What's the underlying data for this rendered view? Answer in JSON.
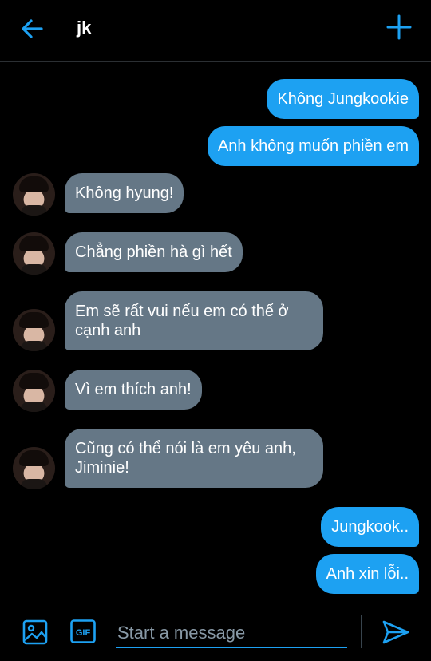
{
  "header": {
    "title": "jk",
    "back_icon": "arrow-left-icon",
    "compose_icon": "plus-icon",
    "accent": "#1da1f2"
  },
  "messages": [
    {
      "side": "out",
      "text": "Không Jungkookie"
    },
    {
      "side": "out",
      "text": "Anh không muốn phiền em"
    },
    {
      "side": "in",
      "text": "Không hyung!"
    },
    {
      "side": "in",
      "text": "Chẳng phiền hà gì hết"
    },
    {
      "side": "in",
      "text": "Em sẽ rất vui nếu em có thể ở cạnh anh"
    },
    {
      "side": "in",
      "text": "Vì em thích anh!"
    },
    {
      "side": "in",
      "text": "Cũng có thể nói là em yêu anh, Jiminie!"
    },
    {
      "side": "out",
      "text": "Jungkook.."
    },
    {
      "side": "out",
      "text": "Anh xin lỗi.."
    }
  ],
  "composer": {
    "placeholder": "Start a message",
    "media_icon": "image-icon",
    "gif_label": "GIF",
    "send_icon": "send-icon"
  },
  "colors": {
    "background": "#000000",
    "outgoing_bubble": "#1da1f2",
    "incoming_bubble": "#657786"
  }
}
